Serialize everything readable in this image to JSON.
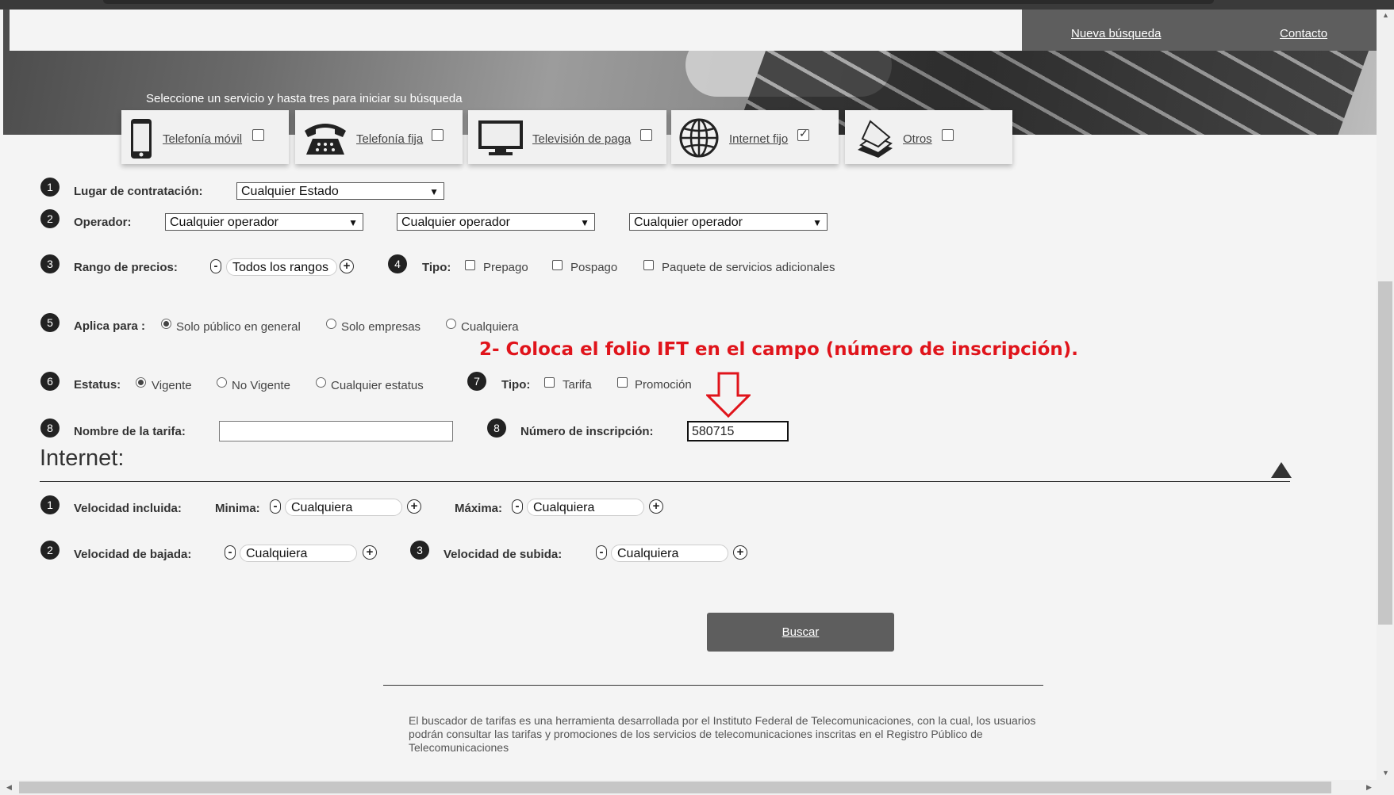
{
  "nav": {
    "new_search": "Nueva búsqueda",
    "contact": "Contacto"
  },
  "hero": {
    "caption": "Seleccione un servicio y hasta tres para iniciar su búsqueda"
  },
  "services": [
    {
      "label": "Telefonía móvil",
      "icon": "mobile-phone-icon",
      "checked": false
    },
    {
      "label": "Telefonía fija",
      "icon": "landline-phone-icon",
      "checked": false
    },
    {
      "label": "Televisión de paga",
      "icon": "television-icon",
      "checked": false
    },
    {
      "label": "Internet fijo",
      "icon": "globe-icon",
      "checked": true
    },
    {
      "label": "Otros",
      "icon": "documents-icon",
      "checked": false
    }
  ],
  "form": {
    "step1": {
      "num": "1",
      "label": "Lugar de contratación:",
      "value": "Cualquier Estado"
    },
    "step2": {
      "num": "2",
      "label": "Operador:",
      "values": [
        "Cualquier operador",
        "Cualquier operador",
        "Cualquier operador"
      ]
    },
    "step3": {
      "num": "3",
      "label": "Rango de precios:",
      "value": "Todos los rangos",
      "minus": "-",
      "plus": "+"
    },
    "step4": {
      "num": "4",
      "label": "Tipo:",
      "options": [
        "Prepago",
        "Pospago",
        "Paquete de servicios adicionales"
      ]
    },
    "step5": {
      "num": "5",
      "label": "Aplica para :",
      "options": [
        "Solo público en general",
        "Solo empresas",
        "Cualquiera"
      ],
      "selected": "Solo público en general"
    },
    "step6": {
      "num": "6",
      "label": "Estatus:",
      "options": [
        "Vigente",
        "No Vigente",
        "Cualquier estatus"
      ],
      "selected": "Vigente"
    },
    "step7": {
      "num": "7",
      "label": "Tipo:",
      "options": [
        "Tarifa",
        "Promoción"
      ]
    },
    "step8a": {
      "num": "8",
      "label": "Nombre de la tarifa:",
      "value": ""
    },
    "step8b": {
      "num": "8",
      "label": "Número de inscripción:",
      "value": "580715"
    }
  },
  "annotation": "2- Coloca el folio IFT en el campo (número de inscripción).",
  "internet": {
    "title": "Internet:",
    "row1": {
      "num": "1",
      "label": "Velocidad incluida:",
      "min_label": "Minima:",
      "min_value": "Cualquiera",
      "max_label": "Máxima:",
      "max_value": "Cualquiera"
    },
    "row2": {
      "num": "2",
      "label": "Velocidad de bajada:",
      "value": "Cualquiera"
    },
    "row3": {
      "num": "3",
      "label": "Velocidad de subida:",
      "value": "Cualquiera"
    }
  },
  "search_button": "Buscar",
  "footer": "El buscador de tarifas es una herramienta desarrollada por el Instituto Federal de Telecomunicaciones, con la cual, los usuarios podrán consultar las tarifas y promociones de los servicios de telecomunicaciones inscritas en el Registro Público de Telecomunicaciones",
  "colors": {
    "annotation": "#e0141b",
    "nav_bg": "#5e5e5e",
    "button_bg": "#5e5e5e"
  }
}
